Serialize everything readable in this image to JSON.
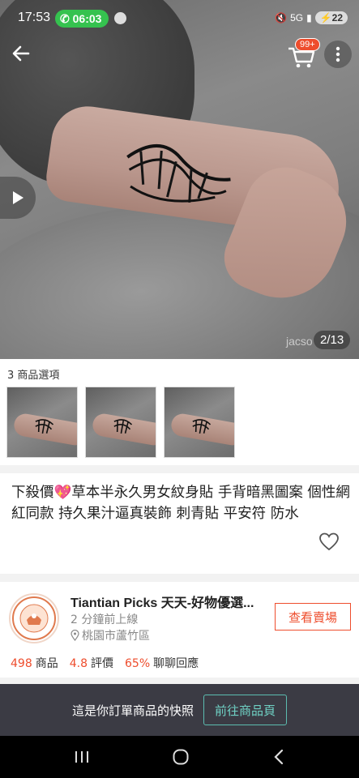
{
  "status_bar": {
    "time": "17:53",
    "call_duration": "06:03",
    "network": "5G",
    "battery": "22"
  },
  "header": {
    "cart_badge": "99+",
    "icons": [
      "back-arrow-icon",
      "cart-icon",
      "more-vertical-icon",
      "play-icon"
    ]
  },
  "gallery": {
    "watermark": "jacso",
    "page_indicator": "2/13"
  },
  "variants": {
    "label": "3 商品選項",
    "count": 3
  },
  "product": {
    "title": "下殺價💖草本半永久男女紋身貼 手背暗黑圖案 個性網紅同款 持久果汁逼真裝飾 刺青貼 平安符 防水"
  },
  "shop": {
    "name": "Tiantian Picks 天天-好物優選...",
    "last_active": "2 分鐘前上線",
    "location": "桃園市蘆竹區",
    "view_button": "查看賣場",
    "logo_text": "TIANTIAN PICKS",
    "stats": [
      {
        "value": "498",
        "label": "商品"
      },
      {
        "value": "4.8",
        "label": "評價"
      },
      {
        "value": "65%",
        "label": "聊聊回應"
      }
    ]
  },
  "snapshot_bar": {
    "text": "這是你訂單商品的快照",
    "button": "前往商品頁"
  },
  "colors": {
    "accent": "#ee4d2d",
    "teal": "#6fd1c4",
    "bar_bg": "#3b3b44"
  }
}
